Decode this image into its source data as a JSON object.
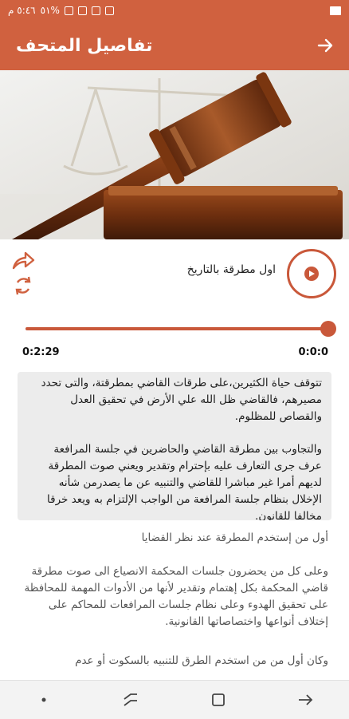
{
  "status": {
    "time": "٥:٤٦ م",
    "battery": "٥١%"
  },
  "appbar": {
    "title": "تفاصيل المتحف"
  },
  "hero": {
    "image": "gavel-and-scales-image"
  },
  "player": {
    "track_title": "اول مطرقة بالتاريخ",
    "current_time": "0:0:0",
    "total_time": "0:2:29",
    "progress": 1.0,
    "accent": "#c9583a"
  },
  "body": {
    "paragraph1": "تتوقف حياة الكثيرين،على طرقات القاضي بمطرقتة، والتى تحدد مصيرهم، فالقاضي ظل الله علي الأرض في تحقيق العدل والقصاص للمظلوم.",
    "paragraph2": "والتجاوب بين مطرقة القاضي والحاضرين في جلسة المرافعة عرف جرى التعارف عليه بإحترام وتقدير ويعني صوت المطرقة لديهم أمرا غير مباشرا للقاضي والتنبيه عن ما يصدرمن شأنه الإخلال بنظام جلسة المرافعة من الواجب الإلتزام به ويعد خرقا مخالفا للقانون.",
    "heading": "أول من إستخدم المطرقة عند نظر القضايا",
    "paragraph3": "وعلى كل من يحضرون جلسات المحكمة الانصياع الى صوت مطرقة قاضي المحكمة بكل إهتمام وتقدير لأنها من الأدوات المهمة للمحافظة على تحقيق الهدوء وعلى نظام جلسات المرافعات للمحاكم على إختلاف أنواعها واختصاصاتها القانونية.",
    "paragraph4": "وكان أول من من استخدم الطرق للتنبيه بالسكوت أو عدم"
  },
  "colors": {
    "primary": "#d0613f",
    "box_bg": "#ececec"
  }
}
